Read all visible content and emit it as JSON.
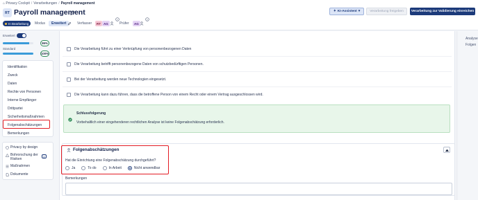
{
  "breadcrumb": {
    "items": [
      "Privacy Cockpit",
      "Verarbeitungen"
    ],
    "current": "Payroll management",
    "separator": "/"
  },
  "header": {
    "badge": "RT",
    "title": "Payroll management",
    "status": "In Bearbeitung",
    "modus_label": "Modus",
    "modus_value": "Erweitert",
    "author_label": "Verfasser",
    "author_initials": [
      "RT",
      "AG"
    ],
    "reviewer_label": "Prüfer",
    "reviewer_initials": [
      "AG"
    ]
  },
  "actions": {
    "ki_assistant": "KI-Assistent",
    "release": "Verarbeitung freigeben",
    "validate": "Verarbeitung zur Validierung einreichen"
  },
  "sidebar": {
    "mode_label": "Erweitert",
    "progress": [
      {
        "label": "",
        "value": "86%",
        "fraction": 0.86
      },
      {
        "label": "Standard",
        "value": "100%",
        "fraction": 1.0
      }
    ],
    "nav_items": [
      "Identifikation",
      "Zweck",
      "Daten",
      "Rechte von Personen",
      "Interne Empfänger",
      "Drittpartei",
      "Sicherheitsmaßnahmen",
      "Folgenabschätzungen",
      "Bemerkungen"
    ],
    "secondary_items": [
      {
        "label": "Privacy by design",
        "icon": "shield-icon"
      },
      {
        "label": "Bohrorschung der",
        "label2": "Risiken",
        "badge": "3",
        "icon": "warning-icon"
      },
      {
        "label": "Maßnahmen",
        "icon": "list-icon"
      },
      {
        "label": "Dokumente",
        "icon": "document-icon"
      }
    ]
  },
  "criteria": [
    "Die Verarbeitung führt zu einer Verknüpfung von personenbezogenen Daten",
    "Die Verarbeitung betrifft personenbezogene Daten von schutzbedürftigen Personen.",
    "Bei der Verarbeitung werden neue Technologien eingesetzt.",
    "Die Verarbeitung kann dazu führen, dass die betroffene Person von einem Recht oder einem Vertrag ausgeschlossen wird."
  ],
  "conclusion": {
    "title": "Schlussfolgerung",
    "text": "Vorbehaltlich einer eingehenderen rechtlichen Analyse ist keine Folgenabschätzung erforderlich."
  },
  "dpia": {
    "title": "Folgenabschätzungen",
    "question": "Hat die Einrichtung eine Folgenabschätzung durchgeführt?",
    "options": [
      "Ja",
      "To do",
      "In Arbeit",
      "Nicht anwendbar"
    ],
    "selected": "Nicht anwendbar",
    "remarks_label": "Bemerkungen",
    "remarks_value": ""
  },
  "right_panel": {
    "links": [
      "Analyse",
      "Folgen"
    ]
  },
  "colors": {
    "brand": "#1c3a7a",
    "highlight": "#e31b23",
    "success_bg": "#e8f6ea",
    "progress": "#3a9bd9"
  }
}
